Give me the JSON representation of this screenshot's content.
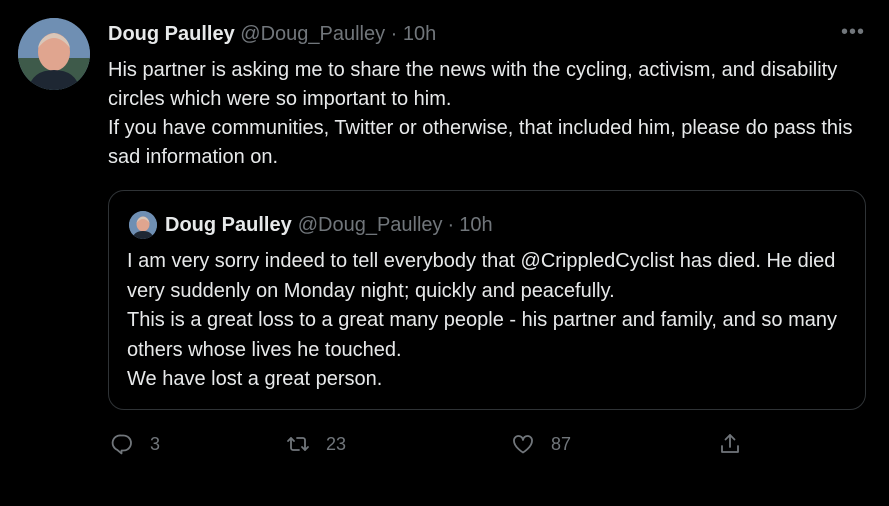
{
  "tweet": {
    "author_name": "Doug Paulley",
    "handle": "@Doug_Paulley",
    "separator": "·",
    "time": "10h",
    "more_label": "•••",
    "body_lines": [
      "His partner is asking me to share the news with the cycling, activism, and disability circles which were so important to him.",
      "If you have communities, Twitter or otherwise, that included him, please do pass this sad information on."
    ]
  },
  "quoted": {
    "author_name": "Doug Paulley",
    "handle": "@Doug_Paulley",
    "separator": "·",
    "time": "10h",
    "body_lines": [
      "I am very sorry indeed to tell everybody that @CrippledCyclist has died. He died very suddenly on Monday night; quickly and peacefully.",
      "This is a great loss to a great many people - his partner and family, and so many others whose lives he touched.",
      "We have lost a great person."
    ]
  },
  "actions": {
    "reply_icon": "reply-icon",
    "reply_count": "3",
    "retweet_icon": "retweet-icon",
    "retweet_count": "23",
    "like_icon": "heart-icon",
    "like_count": "87",
    "share_icon": "share-icon"
  },
  "colors": {
    "background": "#000000",
    "text": "#e7e9ea",
    "muted": "#71767b",
    "border": "#2f3336"
  }
}
